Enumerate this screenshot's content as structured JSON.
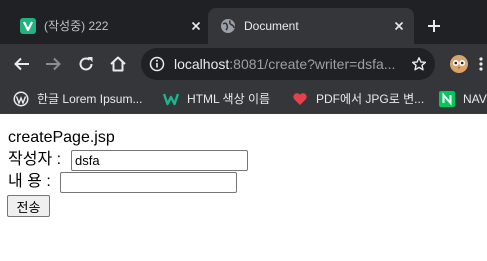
{
  "browser": {
    "tabs": [
      {
        "title": "(작성중) 222",
        "favicon": "v-badge-icon",
        "active": false
      },
      {
        "title": "Document",
        "favicon": "globe-icon",
        "active": true
      }
    ],
    "address": {
      "host": "localhost",
      "rest": ":8081/create?writer=dsfa..."
    },
    "bookmarks": [
      {
        "label": "한글 Lorem Ipsum...",
        "icon": "wordpress-icon"
      },
      {
        "label": "HTML 색상 이름",
        "icon": "w-logo-icon"
      },
      {
        "label": "PDF에서 JPG로 변...",
        "icon": "heart-icon"
      },
      {
        "label": "NAV",
        "icon": "naver-icon"
      }
    ],
    "colors": {
      "chrome_dark": "#202124",
      "chrome_mid": "#35363a",
      "tab_v_green": "#1fb37d"
    }
  },
  "page": {
    "heading": "createPage.jsp",
    "writer_label": "작성자 :",
    "writer_value": "dsfa",
    "content_label": "내 용 :",
    "content_value": "",
    "submit_label": "전송"
  }
}
